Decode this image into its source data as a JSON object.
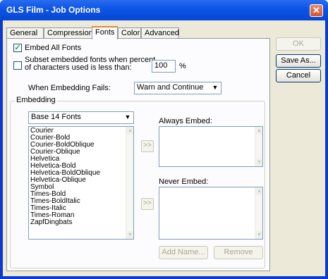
{
  "window": {
    "title": "GLS Film - Job Options",
    "close_glyph": "✕"
  },
  "tabs": [
    {
      "label": "General"
    },
    {
      "label": "Compression"
    },
    {
      "label": "Fonts"
    },
    {
      "label": "Color"
    },
    {
      "label": "Advanced"
    }
  ],
  "active_tab": "Fonts",
  "buttons": {
    "ok": "OK",
    "save_as": "Save As...",
    "cancel": "Cancel"
  },
  "fonts": {
    "embed_all": {
      "label": "Embed All Fonts",
      "checked": true
    },
    "subset": {
      "label_line1": "Subset embedded fonts when percent",
      "label_line2": "of characters used is less than:",
      "checked": false,
      "value": "100",
      "unit": "%"
    },
    "when_fails": {
      "label": "When Embedding Fails:",
      "value": "Warn and Continue"
    },
    "embedding": {
      "group_label": "Embedding",
      "font_source": "Base 14 Fonts",
      "font_list": [
        "Courier",
        "Courier-Bold",
        "Courier-BoldOblique",
        "Courier-Oblique",
        "Helvetica",
        "Helvetica-Bold",
        "Helvetica-BoldOblique",
        "Helvetica-Oblique",
        "Symbol",
        "Times-Bold",
        "Times-BoldItalic",
        "Times-Italic",
        "Times-Roman",
        "ZapfDingbats"
      ],
      "always_embed_label": "Always Embed:",
      "never_embed_label": "Never Embed:",
      "move_glyph": ">>",
      "add_name": "Add Name...",
      "remove": "Remove"
    }
  },
  "colors": {
    "accent": "#0a3ad0",
    "tab_highlight": "#e68b2c",
    "dialog_bg": "#ece9d8"
  }
}
